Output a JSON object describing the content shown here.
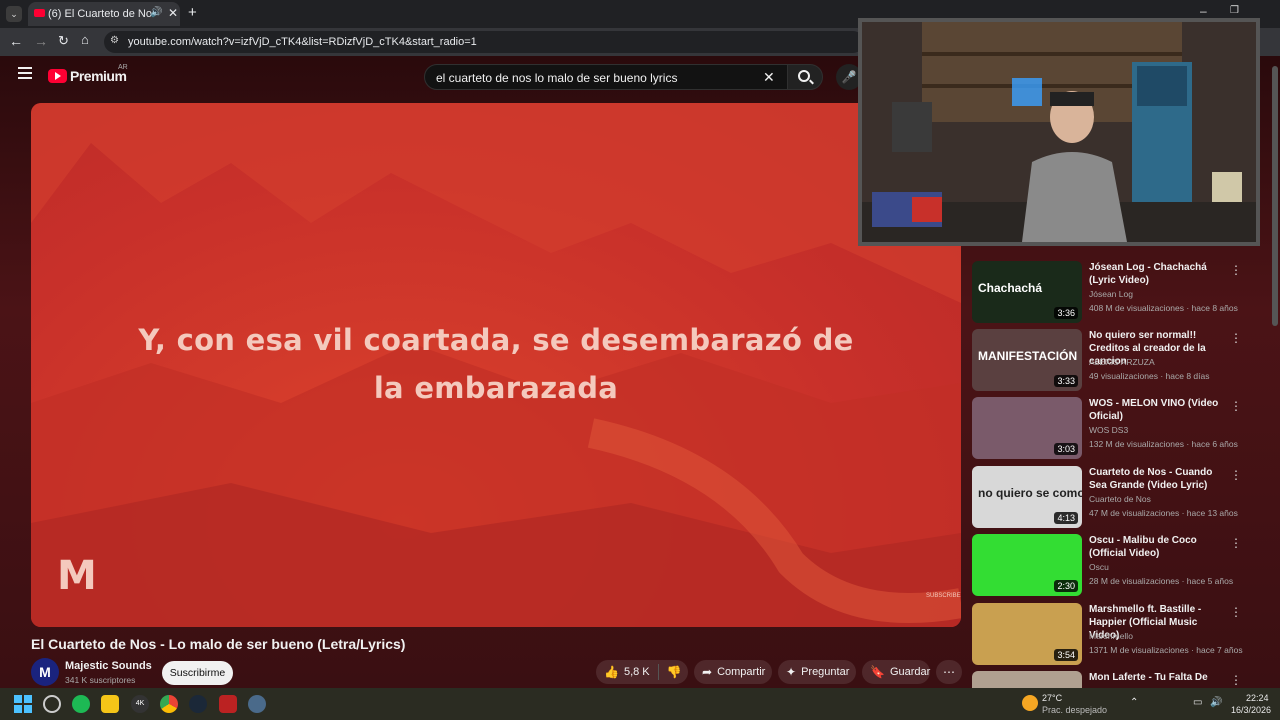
{
  "browser": {
    "tab_title": "(6) El Cuarteto de Nos - Lo",
    "url": "youtube.com/watch?v=izfVjD_cTK4&list=RDizfVjD_cTK4&start_radio=1"
  },
  "masthead": {
    "logo_text": "Premium",
    "region": "AR",
    "search_value": "el cuarteto de nos lo malo de ser bueno lyrics"
  },
  "player": {
    "lyric_line1": "Y, con esa vil coartada, se desembarazó de",
    "lyric_line2": "la embarazada",
    "watermark_logo": "M",
    "subscribe_mark": "SUBSCRIBE"
  },
  "video": {
    "title": "El Cuarteto de Nos - Lo malo de ser bueno (Letra/Lyrics)",
    "channel": "Majestic Sounds",
    "subscribers": "341 K suscriptores",
    "subscribe_label": "Suscribirme",
    "likes": "5,8 K",
    "share_label": "Compartir",
    "ask_label": "Preguntar",
    "save_label": "Guardar"
  },
  "recommendations": [
    {
      "title": "Jósean Log - Chachachá (Lyric Video)",
      "channel": "Jósean Log",
      "meta": "408 M de visualizaciones · hace 8 años",
      "duration": "3:36",
      "thumb_text": "Chachachá",
      "thumb_color": "#1a2a1a"
    },
    {
      "title": "No quiero ser normal!! Creditos al creador de la cancion",
      "channel": "ALEXIS ARZUZA",
      "meta": "49 visualizaciones · hace 8 días",
      "duration": "3:33",
      "thumb_text": "MANIFESTACIÓN",
      "thumb_color": "#5a4040"
    },
    {
      "title": "WOS - MELON VINO (Video Oficial)",
      "channel": "WOS DS3",
      "meta": "132 M de visualizaciones · hace 6 años",
      "duration": "3:03",
      "thumb_text": "",
      "thumb_color": "#7a5a6a"
    },
    {
      "title": "Cuarteto de Nos - Cuando Sea Grande (Video Lyric)",
      "channel": "Cuarteto de Nos",
      "meta": "47 M de visualizaciones · hace 13 años",
      "duration": "4:13",
      "thumb_text": "no quiero se como vo",
      "thumb_color": "#d8d8d8"
    },
    {
      "title": "Oscu - Malibu de Coco (Official Video)",
      "channel": "Oscu",
      "meta": "28 M de visualizaciones · hace 5 años",
      "duration": "2:30",
      "thumb_text": "",
      "thumb_color": "#33dd33"
    },
    {
      "title": "Marshmello ft. Bastille - Happier (Official Music Video)",
      "channel": "Marshmello",
      "meta": "1371 M de visualizaciones · hace 7 años",
      "duration": "3:54",
      "thumb_text": "",
      "thumb_color": "#c9a050"
    },
    {
      "title": "Mon Laferte - Tu Falta De",
      "channel": "",
      "meta": "",
      "duration": "",
      "thumb_text": "",
      "thumb_color": "#b0a090"
    }
  ],
  "taskbar": {
    "weather_temp": "27°C",
    "weather_desc": "Prac. despejado",
    "time": "22:24",
    "date": "16/3/2026"
  },
  "colors": {
    "youtube_red": "#ff0033",
    "accent": "#3ea6ff"
  }
}
